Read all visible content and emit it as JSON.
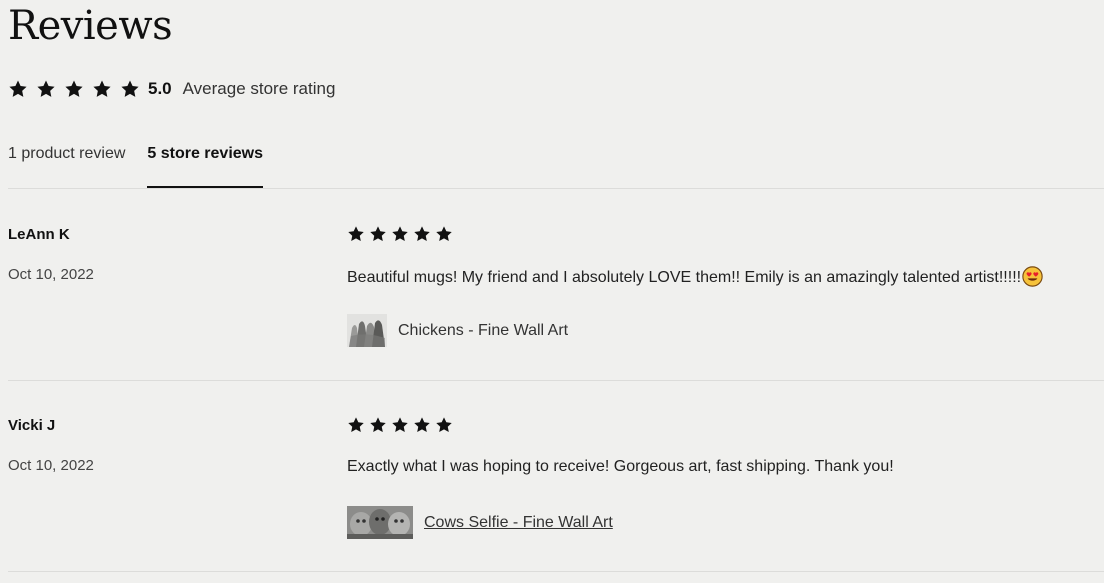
{
  "header": {
    "title": "Reviews",
    "rating_value": "5.0",
    "rating_label": "Average store rating",
    "rating_stars": 5
  },
  "tabs": [
    {
      "label": "1 product review",
      "active": false
    },
    {
      "label": "5 store reviews",
      "active": true
    }
  ],
  "reviews": [
    {
      "name": "LeAnn K",
      "date": "Oct 10, 2022",
      "stars": 5,
      "text": "Beautiful mugs! My friend and I absolutely LOVE them!! Emily is an amazingly talented artist!!!!!",
      "emoji": "heart-eyes-emoji",
      "product": "Chickens - Fine Wall Art"
    },
    {
      "name": "Vicki J",
      "date": "Oct 10, 2022",
      "stars": 5,
      "text": "Exactly what I was hoping to receive! Gorgeous art, fast shipping. Thank you!",
      "product": "Cows Selfie - Fine Wall Art"
    }
  ],
  "colors": {
    "background": "#f0f0ee",
    "star": "#111111",
    "divider": "#dcdcda"
  }
}
